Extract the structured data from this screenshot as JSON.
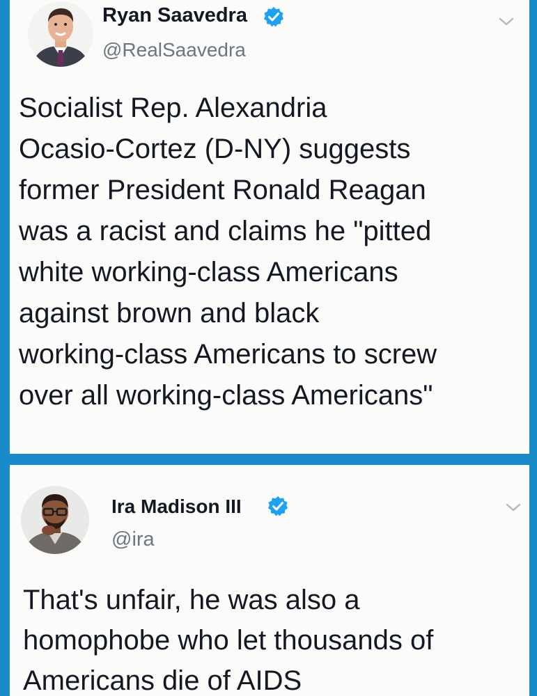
{
  "colors": {
    "background_blue": "#1a8bc9",
    "card": "#fbfbf9",
    "text": "#141823",
    "handle": "#6d7680",
    "verified": "#1da1f2"
  },
  "tweets": [
    {
      "author_name": "Ryan Saavedra",
      "handle": "@RealSaavedra",
      "verified": true,
      "text": "Socialist Rep. Alexandria\nOcasio-Cortez (D-NY) suggests\nformer President Ronald Reagan\nwas a racist and claims he \"pitted\nwhite working-class Americans\nagainst brown and black\nworking-class Americans to screw\nover all working-class Americans\"",
      "icons": [
        "avatar",
        "verified-badge-icon",
        "chevron-down-icon"
      ]
    },
    {
      "author_name": "Ira Madison III",
      "handle": "@ira",
      "verified": true,
      "text": "That's unfair, he was also a\nhomophobe who let thousands of\nAmericans die of AIDS",
      "icons": [
        "avatar",
        "verified-badge-icon",
        "chevron-down-icon"
      ]
    }
  ]
}
